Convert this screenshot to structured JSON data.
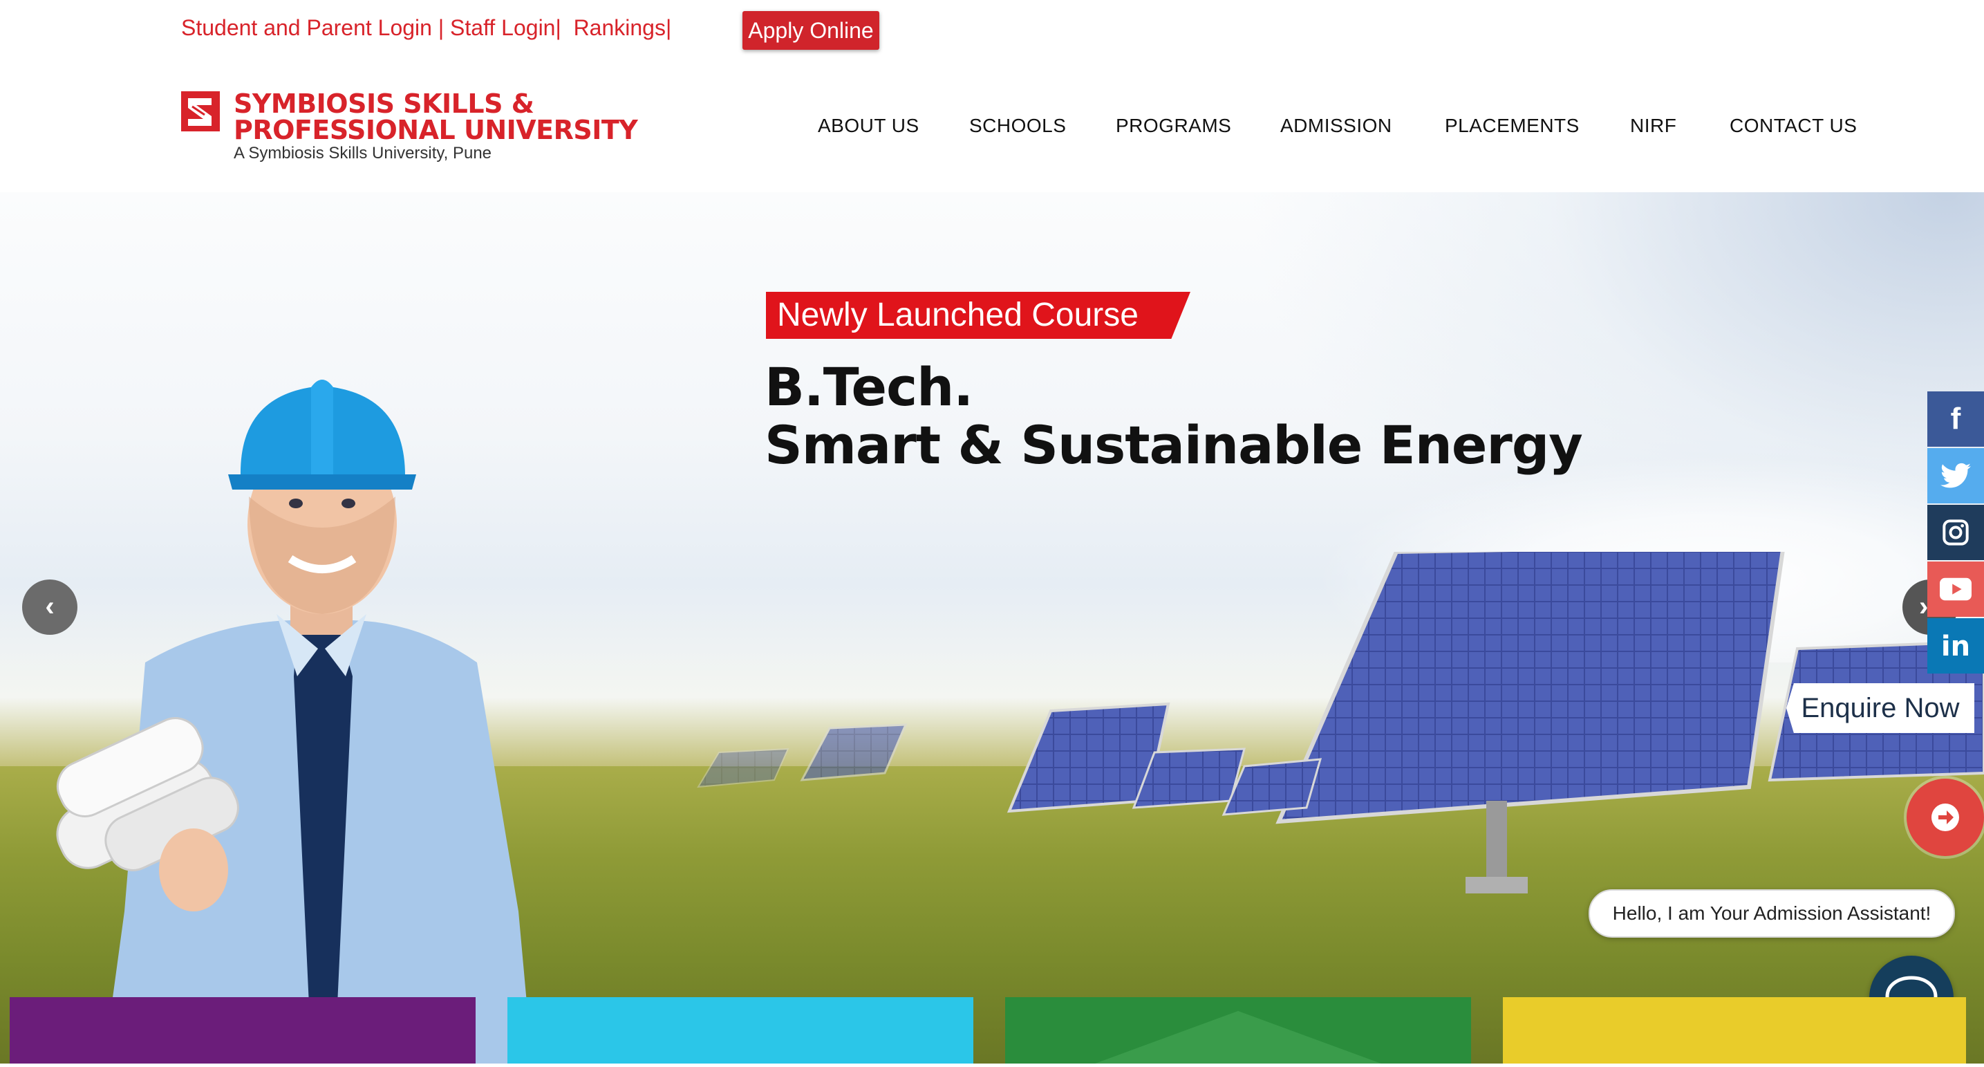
{
  "topbar": {
    "links_text": "Student and Parent Login | Staff Login|  Rankings|",
    "links": [
      "Student and Parent Login",
      "Staff Login",
      "Rankings"
    ],
    "apply_label": "Apply Online"
  },
  "logo": {
    "line1": "SYMBIOSIS SKILLS &",
    "line2": "PROFESSIONAL UNIVERSITY",
    "subtitle": "A Symbiosis Skills University, Pune"
  },
  "nav": {
    "items": [
      "ABOUT US",
      "SCHOOLS",
      "PROGRAMS",
      "ADMISSION",
      "PLACEMENTS",
      "NIRF",
      "CONTACT US"
    ]
  },
  "hero": {
    "badge": "Newly Launched Course",
    "title_line1": "B.Tech.",
    "title_line2": "Smart & Sustainable Energy",
    "prev_icon": "chevron-left-icon",
    "next_icon": "chevron-right-icon"
  },
  "social": [
    {
      "name": "facebook-icon",
      "glyph": "f",
      "color": "#3b5998"
    },
    {
      "name": "twitter-icon",
      "glyph": "t",
      "color": "#55acee"
    },
    {
      "name": "instagram-icon",
      "glyph": "◎",
      "color": "#1f3c5c"
    },
    {
      "name": "youtube-icon",
      "glyph": "▶",
      "color": "#e85a56"
    },
    {
      "name": "linkedin-icon",
      "glyph": "in",
      "color": "#0a78b5"
    }
  ],
  "enquire": {
    "label": "Enquire Now",
    "go_icon": "arrow-circle-right-icon"
  },
  "assistant": {
    "message": "Hello, I am Your Admission Assistant!",
    "chat_icon": "chat-bubble-icon"
  },
  "cards": [
    {
      "color": "#6b1d7a"
    },
    {
      "color": "#2bc6e8"
    },
    {
      "color": "#2a8d3c"
    },
    {
      "color": "#e9cc2a"
    }
  ],
  "colors": {
    "brand_red": "#d8232a",
    "nav_text": "#111111"
  }
}
